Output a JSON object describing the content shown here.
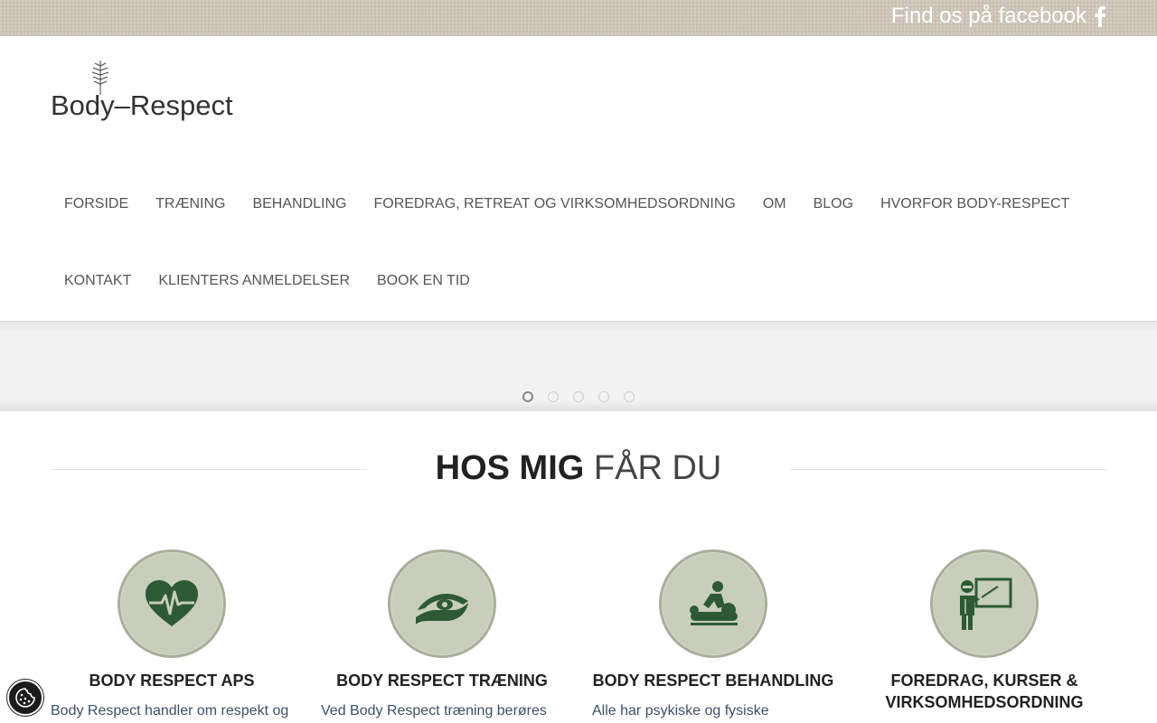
{
  "topbar": {
    "facebook_link": "Find os på facebook",
    "facebook_icon": "facebook-icon"
  },
  "header": {
    "logo_text": "Body–Respect",
    "logo_icon": "tree-icon"
  },
  "nav": {
    "row1": [
      "FORSIDE",
      "TRÆNING",
      "BEHANDLING",
      "FOREDRAG, RETREAT OG VIRKSOMHEDSORDNING",
      "OM",
      "BLOG",
      "HVORFOR BODY-RESPECT"
    ],
    "row2": [
      "KONTAKT",
      "KLIENTERS ANMELDELSER",
      "BOOK EN TID"
    ]
  },
  "slider": {
    "slide_count": 5,
    "active_slide": 1
  },
  "section": {
    "title_bold": "HOS MIG",
    "title_rest": "FÅR DU"
  },
  "features": [
    {
      "icon": "heartbeat-icon",
      "title": "BODY RESPECT APS",
      "text": "Body Respect handler om respekt og"
    },
    {
      "icon": "hand-eye-icon",
      "title": "BODY RESPECT TRÆNING",
      "text": "Ved Body Respect træning berøres"
    },
    {
      "icon": "massage-icon",
      "title": "BODY RESPECT BEHANDLING",
      "text": "Alle har psykiske og fysiske"
    },
    {
      "icon": "presenter-icon",
      "title": "FOREDRAG, KURSER & VIRKSOMHEDSORDNING",
      "text": ""
    }
  ],
  "cookie": {
    "icon": "cookie-icon"
  },
  "colors": {
    "accent_green": "#2d5a35",
    "circle_bg": "#c8cebb",
    "topbar_bg": "#c9c2b4"
  }
}
